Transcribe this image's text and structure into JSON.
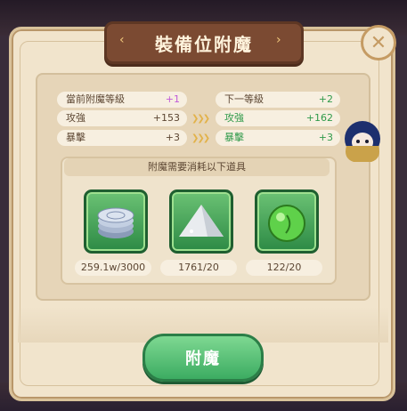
{
  "dialog": {
    "title": "裝備位附魔",
    "close_icon": "close-icon",
    "current_level_label": "當前附魔等級",
    "current_level_value": "+1",
    "next_level_label": "下一等級",
    "next_level_value": "+2",
    "stats": [
      {
        "label": "攻強",
        "current": "+153",
        "next_label": "攻強",
        "next": "+162"
      },
      {
        "label": "暴擊",
        "current": "+3",
        "next_label": "暴擊",
        "next": "+3"
      }
    ],
    "items_header": "附魔需要消耗以下道具",
    "items": [
      {
        "icon": "silver-coins-icon",
        "count": "259.1w/3000"
      },
      {
        "icon": "white-powder-pile-icon",
        "count": "1761/20"
      },
      {
        "icon": "green-potion-icon",
        "count": "122/20"
      }
    ],
    "enchant_button": "附魔"
  },
  "colors": {
    "accent_green": "#2f9a4a",
    "plus_purple": "#c05ad8",
    "title_brown": "#7b4a32"
  }
}
